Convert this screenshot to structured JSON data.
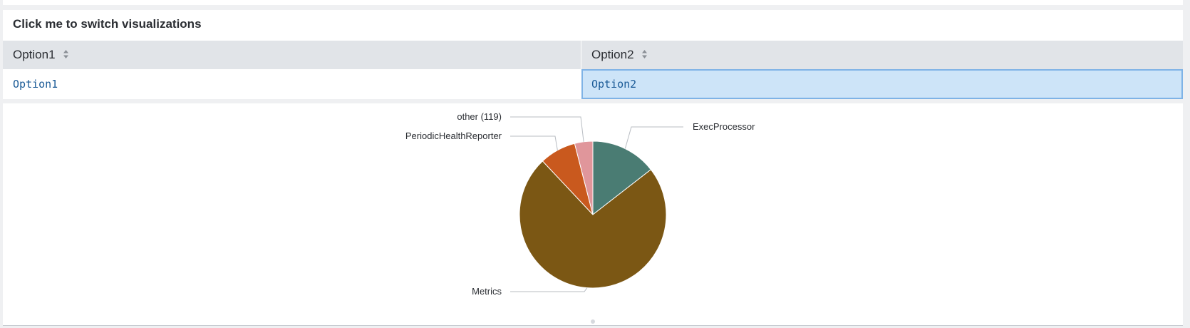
{
  "panel": {
    "title": "Click me to switch visualizations"
  },
  "table": {
    "columns": [
      "Option1",
      "Option2"
    ],
    "rows": [
      [
        "Option1",
        "Option2"
      ]
    ],
    "selected_cell": "Option2"
  },
  "icons": {
    "sort": "sort-icon"
  },
  "colors": {
    "header_bg": "#e1e4e8",
    "link": "#1a5a96",
    "selected_bg": "#cde4f8",
    "selected_border": "#7fb3e6"
  },
  "chart_data": {
    "type": "pie",
    "slices": [
      {
        "label": "ExecProcessor",
        "value": 14.5,
        "color": "#4a7c73"
      },
      {
        "label": "Metrics",
        "value": 73.5,
        "color": "#7b5714"
      },
      {
        "label": "PeriodicHealthReporter",
        "value": 8.0,
        "color": "#c9591e"
      },
      {
        "label": "other (119)",
        "value": 4.0,
        "color": "#e0969b"
      }
    ]
  }
}
